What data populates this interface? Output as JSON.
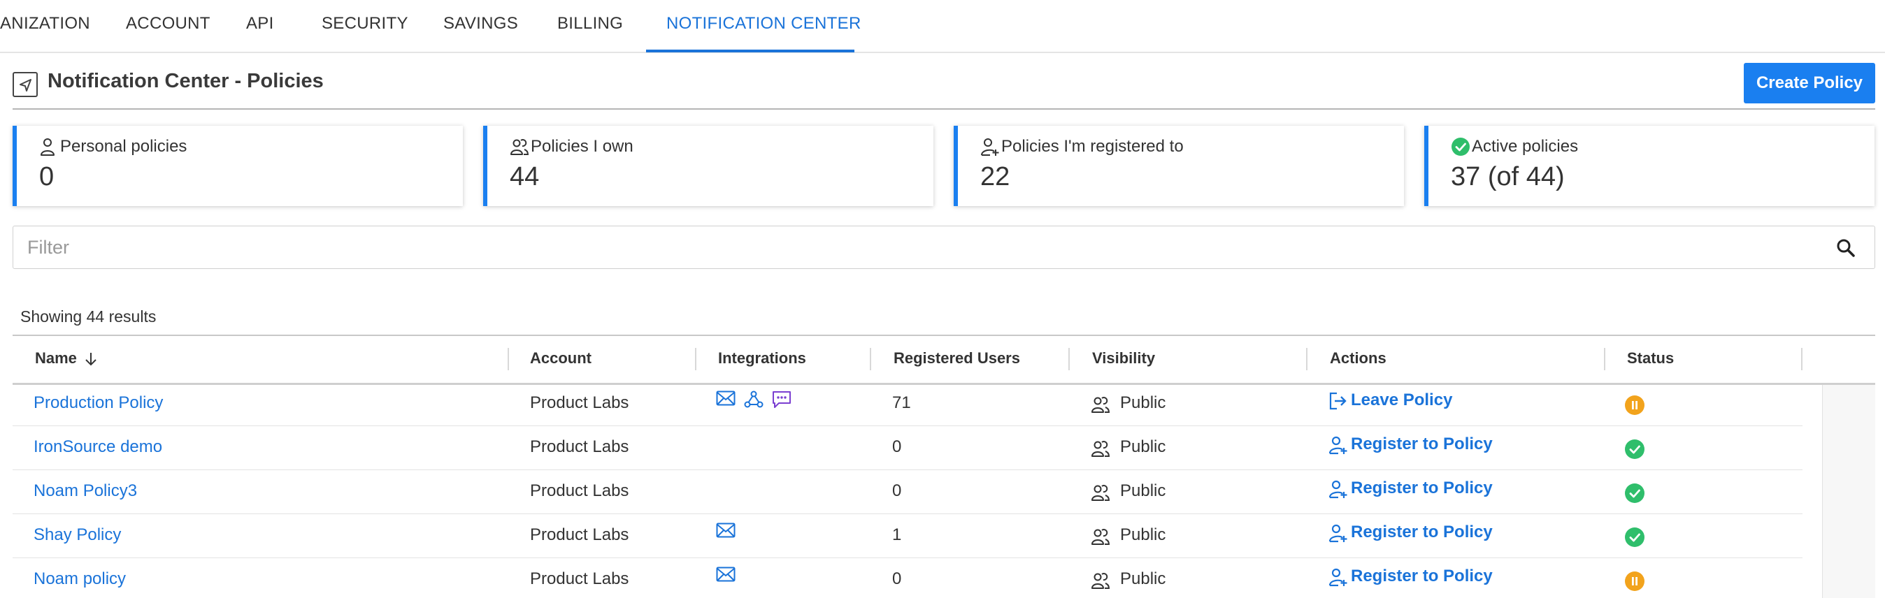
{
  "nav": {
    "tabs": [
      {
        "label": "ANIZATION"
      },
      {
        "label": "ACCOUNT"
      },
      {
        "label": "API"
      },
      {
        "label": "SECURITY"
      },
      {
        "label": "SAVINGS"
      },
      {
        "label": "BILLING"
      },
      {
        "label": "NOTIFICATION CENTER",
        "active": true
      }
    ]
  },
  "header": {
    "title": "Notification Center - Policies",
    "create_label": "Create Policy",
    "back_icon": "back-arrow-icon"
  },
  "cards": [
    {
      "label": "Personal policies",
      "value": "0",
      "icon": "user-icon"
    },
    {
      "label": "Policies I own",
      "value": "44",
      "icon": "users-icon"
    },
    {
      "label": "Policies I'm registered to",
      "value": "22",
      "icon": "user-plus-icon"
    },
    {
      "label": "Active policies",
      "value": "37 (of 44)",
      "icon": "check-circle-icon"
    }
  ],
  "filter": {
    "placeholder": "Filter",
    "value": "",
    "icon": "search-icon"
  },
  "results_text": "Showing 44 results",
  "table": {
    "headers": {
      "name": "Name",
      "account": "Account",
      "integrations": "Integrations",
      "registered_users": "Registered Users",
      "visibility": "Visibility",
      "actions": "Actions",
      "status": "Status"
    },
    "sort_icon": "arrow-down-icon",
    "rows": [
      {
        "name": "Production Policy",
        "account": "Product Labs",
        "integrations": [
          "email",
          "webhook",
          "chat"
        ],
        "registered_users": "71",
        "visibility": "Public",
        "action": "Leave Policy",
        "status": "paused"
      },
      {
        "name": "IronSource demo",
        "account": "Product Labs",
        "integrations": [],
        "registered_users": "0",
        "visibility": "Public",
        "action": "Register to Policy",
        "status": "active"
      },
      {
        "name": "Noam Policy3",
        "account": "Product Labs",
        "integrations": [],
        "registered_users": "0",
        "visibility": "Public",
        "action": "Register to Policy",
        "status": "active"
      },
      {
        "name": "Shay Policy",
        "account": "Product Labs",
        "integrations": [
          "email"
        ],
        "registered_users": "1",
        "visibility": "Public",
        "action": "Register to Policy",
        "status": "active"
      },
      {
        "name": "Noam policy",
        "account": "Product Labs",
        "integrations": [
          "email"
        ],
        "registered_users": "0",
        "visibility": "Public",
        "action": "Register to Policy",
        "status": "paused"
      }
    ]
  },
  "colors": {
    "accent": "#1a7ff0",
    "link": "#1a73d9",
    "status_active": "#2fbe6b",
    "status_paused": "#f2a31c",
    "integration_email": "#1a73d9",
    "integration_webhook": "#1a73d9",
    "integration_chat": "#7b3fd1"
  }
}
